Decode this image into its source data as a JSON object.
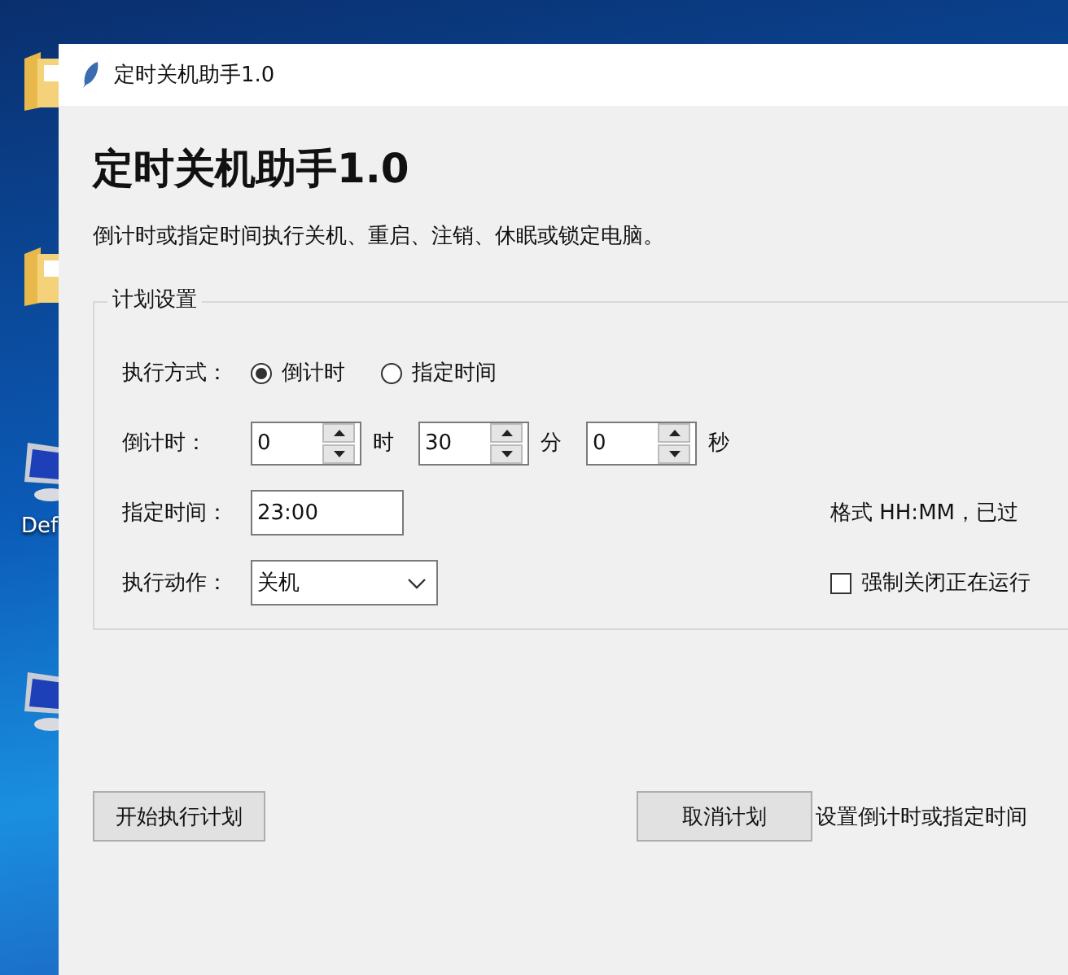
{
  "desktop": {
    "icons": [
      {
        "kind": "folder"
      },
      {
        "kind": "folder"
      },
      {
        "kind": "monitor",
        "label": "Def"
      },
      {
        "kind": "monitor"
      }
    ]
  },
  "window": {
    "title": "定时关机助手1.0"
  },
  "heading": "定时关机助手1.0",
  "description": "倒计时或指定时间执行关机、重启、注销、休眠或锁定电脑。",
  "group": {
    "title": "计划设置",
    "mode": {
      "label": "执行方式：",
      "options": [
        {
          "label": "倒计时",
          "selected": true
        },
        {
          "label": "指定时间",
          "selected": false
        }
      ]
    },
    "countdown": {
      "label": "倒计时：",
      "fields": [
        {
          "value": "0",
          "unit": "时"
        },
        {
          "value": "30",
          "unit": "分"
        },
        {
          "value": "0",
          "unit": "秒"
        }
      ]
    },
    "time": {
      "label": "指定时间：",
      "value": "23:00",
      "hint": "格式 HH:MM，已过"
    },
    "action": {
      "label": "执行动作：",
      "value": "关机",
      "force": {
        "label": "强制关闭正在运行",
        "checked": false
      }
    }
  },
  "buttons": [
    {
      "label": "开始执行计划"
    },
    {
      "label": "取消计划"
    }
  ],
  "status": "设置倒计时或指定时间"
}
